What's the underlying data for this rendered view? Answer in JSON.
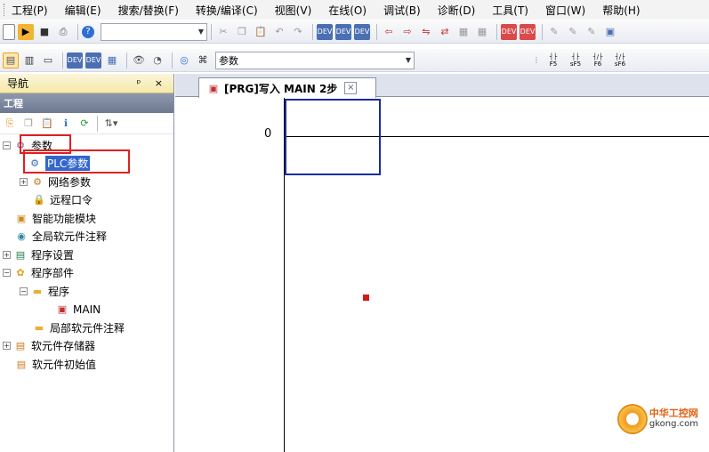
{
  "menu": [
    "工程(P)",
    "编辑(E)",
    "搜索/替换(F)",
    "转换/编译(C)",
    "视图(V)",
    "在线(O)",
    "调试(B)",
    "诊断(D)",
    "工具(T)",
    "窗口(W)",
    "帮助(H)"
  ],
  "toolbar2": {
    "combo_value": "参数",
    "fkeys": [
      "F5",
      "sF5",
      "F6",
      "sF6"
    ]
  },
  "nav": {
    "title": "导航",
    "pin": "ᵖ",
    "close": "×",
    "section": "工程",
    "tree": [
      {
        "label": "参数",
        "exp": "−"
      },
      {
        "label": "PLC参数",
        "exp": ""
      },
      {
        "label": "网络参数",
        "exp": "+"
      },
      {
        "label": "远程口令",
        "exp": ""
      },
      {
        "label": "智能功能模块",
        "exp": ""
      },
      {
        "label": "全局软元件注释",
        "exp": ""
      },
      {
        "label": "程序设置",
        "exp": "+"
      },
      {
        "label": "程序部件",
        "exp": "−"
      },
      {
        "label": "程序",
        "exp": "−"
      },
      {
        "label": "MAIN",
        "exp": ""
      },
      {
        "label": "局部软元件注释",
        "exp": ""
      },
      {
        "label": "软元件存储器",
        "exp": "+"
      },
      {
        "label": "软元件初始值",
        "exp": ""
      }
    ]
  },
  "editor": {
    "tab_title": "[PRG]写入 MAIN 2步",
    "tab_close": "×",
    "step_number": "0"
  },
  "watermark": {
    "cn": "中华工控网",
    "en": "gkong.com"
  },
  "colors": {
    "selection": "#3266cc",
    "highlight_box": "#e02020",
    "cursor_box": "#1b2b9a",
    "nav_section": "#7a849a"
  }
}
